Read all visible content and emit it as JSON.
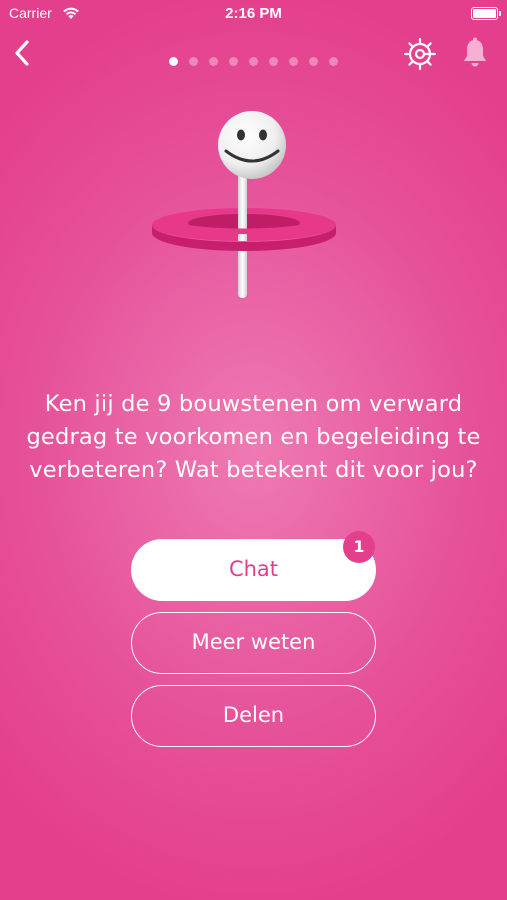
{
  "status_bar": {
    "carrier": "Carrier",
    "time": "2:16 PM",
    "battery_level": 1.0
  },
  "nav": {
    "back_icon": "chevron-left-icon",
    "settings_icon": "gear-icon",
    "notifications_icon": "bell-icon",
    "page_indicator": {
      "total": 9,
      "current": 1
    }
  },
  "illustration": {
    "description_icon": "smiley-lollipop-with-ring"
  },
  "content": {
    "question": "Ken jij de 9 bouwstenen om verward gedrag te voorkomen en begeleiding te verbeteren? Wat betekent dit voor jou?"
  },
  "actions": {
    "chat_label": "Chat",
    "chat_badge": "1",
    "more_label": "Meer weten",
    "share_label": "Delen"
  },
  "colors": {
    "background": "#e6529a",
    "accent": "#e0408a",
    "text": "#ffffff"
  }
}
